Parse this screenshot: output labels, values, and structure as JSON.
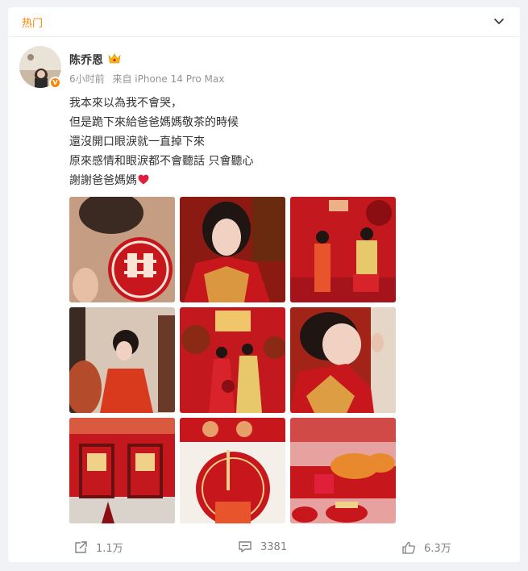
{
  "card": {
    "tag": "热门"
  },
  "post": {
    "author": "陈乔恩",
    "time": "6小时前",
    "source": "来自 iPhone 14 Pro Max",
    "lines": [
      "我本來以為我不會哭，",
      "但是跪下來給爸爸媽媽敬茶的時候",
      "還沒開口眼淚就一直掉下來",
      "原來感情和眼淚都不會聽話 只會聽心",
      "謝謝爸爸媽媽"
    ],
    "verified_badge": "V",
    "images": [
      "double-happiness-cutout",
      "bride-portrait",
      "couple-seated-ceremony",
      "bride-with-family",
      "couple-standing-flowers",
      "bride-close-up",
      "red-chairs-double-happiness",
      "red-decor-detail",
      "tea-set-persimmons"
    ]
  },
  "actions": {
    "repost": "1.1万",
    "comment": "3381",
    "like": "6.3万"
  },
  "icons": {
    "collapse": "chevron-down-icon",
    "crown": "crown-icon",
    "heart": "heart-icon",
    "repost": "share-icon",
    "comment": "comment-icon",
    "like": "thumbs-up-icon"
  },
  "colors": {
    "accent": "#ff8200",
    "heart": "#e0203a",
    "wedding_red": "#c8161d"
  }
}
